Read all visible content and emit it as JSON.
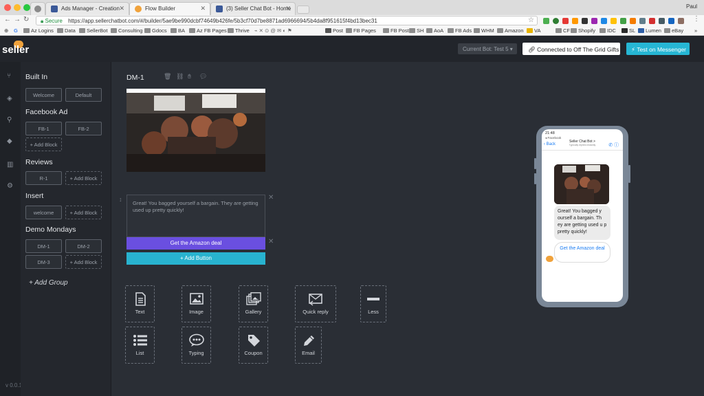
{
  "browser": {
    "tabs": [
      {
        "label": "Ads Manager - Creation"
      },
      {
        "label": "Flow Builder"
      },
      {
        "label": "(3) Seller Chat Bot - Home"
      }
    ],
    "user": "Paul",
    "secure_label": "Secure",
    "url": "https://app.sellerchatbot.com/#/builder/5ae9be990dcbf74649b426fe/5b3cf70d7be8871ad6966694/5b4da8f951615f4bd13bec31",
    "bookmarks": [
      "Az Logins",
      "Data",
      "SellerBot",
      "Consulting",
      "Gdocs",
      "BA",
      "Az FB Pages",
      "Thrive",
      "Post",
      "FB Pages",
      "FB Posts",
      "SH",
      "AoA",
      "FB Ads",
      "WHM",
      "Amazon",
      "VA",
      "CF",
      "Shopify",
      "IDC",
      "SL",
      "Lumen",
      "eBay"
    ]
  },
  "header": {
    "logo": "seller",
    "current_bot": "Current Bot: Test 5",
    "connected": "Connected to Off The Grid Gifts",
    "test_button": "Test on Messenger"
  },
  "sidebar": {
    "groups": [
      {
        "title": "Built In",
        "blocks": [
          "Welcome",
          "Default"
        ]
      },
      {
        "title": "Facebook Ad",
        "blocks": [
          "FB-1",
          "FB-2"
        ],
        "add": "Add Block"
      },
      {
        "title": "Reviews",
        "blocks": [
          "R-1"
        ],
        "add": "Add Block"
      },
      {
        "title": "Insert",
        "blocks": [
          "welcome"
        ],
        "add": "Add Block"
      },
      {
        "title": "Demo Mondays",
        "blocks": [
          "DM-1",
          "DM-2",
          "DM-3"
        ],
        "add": "Add Block"
      }
    ],
    "add_group": "+ Add Group",
    "version": "v 0.0.1"
  },
  "editor": {
    "block_title": "DM-1",
    "message_text": "Great! You bagged yourself a bargain. They are getting used up pretty quickly!",
    "button_label": "Get the Amazon deal",
    "add_button": "+ Add Button",
    "tiles": [
      "Text",
      "Image",
      "Gallery",
      "Quick reply",
      "Less",
      "List",
      "Typing",
      "Coupon",
      "Email"
    ]
  },
  "preview": {
    "time": "21:48",
    "app": "◂ Facebook",
    "back": "Back",
    "title": "Seller Chat Bot >",
    "subtitle": "Typically replies instantly",
    "message": "Great! You bagged y ourself a bargain. Th ey are getting used u p pretty quickly!",
    "deal_button": "Get the Amazon deal"
  },
  "colors": {
    "accent_cyan": "#26b6d4",
    "button_purple": "#6a4fe0",
    "brand_orange": "#f0a23b"
  }
}
